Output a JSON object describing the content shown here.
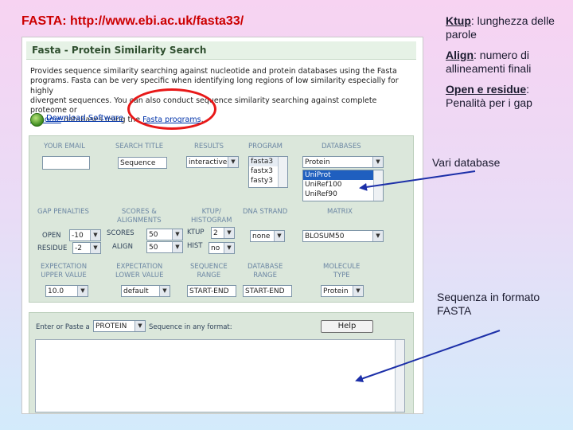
{
  "slide": {
    "title": "FASTA:  http://www.ebi.ac.uk/fasta33/",
    "notes": [
      {
        "term": "Ktup",
        "text": ": lunghezza delle parole"
      },
      {
        "term": "Align",
        "text": ": numero di allineamenti finali"
      },
      {
        "term": "Open e residue",
        "text": ": Penalità per i gap"
      }
    ],
    "callout_databases": "Vari database",
    "callout_sequence": "Sequenza in formato FASTA",
    "colors": {
      "title": "#cc0000",
      "annotation": "#e81818",
      "arrow": "#1c2fa8"
    }
  },
  "page": {
    "heading": "Fasta - Protein Similarity Search",
    "intro_line1": "Provides sequence similarity searching against nucleotide and protein databases using the Fasta",
    "intro_line2": "programs. Fasta can be very specific when identifying long regions of low similarity especially for highly",
    "intro_line3": "divergent sequences. You can also conduct sequence similarity searching against complete proteome or",
    "intro_link1": "genome",
    "intro_mid": " databases using the ",
    "intro_link2": "Fasta programs",
    "intro_end": ".",
    "download_label": "Download Software",
    "download_icon": "download-globe-icon"
  },
  "form": {
    "headers_row1": {
      "email": "YOUR EMAIL",
      "search_title": "SEARCH TITLE",
      "results": "RESULTS",
      "program": "PROGRAM",
      "databases": "DATABASES"
    },
    "search_title_value": "Sequence",
    "results_value": "interactive",
    "program_options": [
      "fasta3",
      "fastx3",
      "fasty3"
    ],
    "database_select": "Protein",
    "database_options": [
      "UniProt",
      "UniRef100",
      "UniRef90"
    ],
    "headers_row2": {
      "gap": "GAP PENALTIES",
      "scores": "SCORES &\nALIGNMENTS",
      "ktup": "KTUP/\nHISTOGRAM",
      "strand": "DNA STRAND",
      "matrix": "MATRIX"
    },
    "open_label": "OPEN",
    "open_value": "-10",
    "residue_label": "RESIDUE",
    "residue_value": "-2",
    "scores_label": "SCORES",
    "scores_value": "50",
    "align_label": "ALIGN",
    "align_value": "50",
    "ktup_label": "KTUP",
    "ktup_value": "2",
    "hist_label": "HIST",
    "hist_value": "no",
    "strand_value": "none",
    "matrix_value": "BLOSUM50",
    "headers_row3": {
      "exp_upper": "EXPECTATION\nUPPER VALUE",
      "exp_lower": "EXPECTATION\nLOWER VALUE",
      "seq_range": "SEQUENCE\nRANGE",
      "db_range": "DATABASE\nRANGE",
      "mol_type": "MOLECULE\nTYPE"
    },
    "exp_upper_value": "10.0",
    "exp_lower_value": "default",
    "seq_range_value": "START-END",
    "db_range_value": "START-END",
    "mol_type_value": "Protein",
    "enter_prefix": "Enter or Paste a",
    "format_value": "PROTEIN",
    "enter_suffix": "Sequence in any format:",
    "help_label": "Help"
  }
}
